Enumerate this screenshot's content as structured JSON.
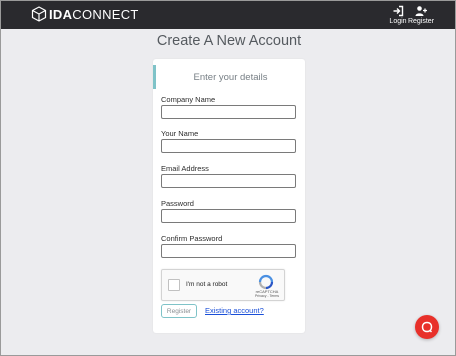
{
  "header": {
    "logo_bold": "IDA",
    "logo_light": "CONNECT",
    "nav": {
      "login_label": "Login",
      "register_label": "Register"
    }
  },
  "page": {
    "title": "Create A New Account"
  },
  "form": {
    "heading": "Enter your details",
    "fields": [
      {
        "label": "Company Name",
        "value": ""
      },
      {
        "label": "Your Name",
        "value": ""
      },
      {
        "label": "Email Address",
        "value": ""
      },
      {
        "label": "Password",
        "value": ""
      },
      {
        "label": "Confirm Password",
        "value": ""
      }
    ],
    "recaptcha": {
      "label": "I'm not a robot",
      "brand": "reCAPTCHA",
      "links": "Privacy - Terms"
    },
    "register_button": "Register",
    "existing_link": "Existing account?"
  },
  "colors": {
    "topbar": "#2a2a2e",
    "accent": "#7fc3c8",
    "link": "#1a4fd8",
    "help": "#e8302a",
    "background": "#ececef"
  },
  "icons": [
    "cube-logo-icon",
    "login-icon",
    "add-user-icon",
    "recaptcha-icon",
    "chat-help-icon"
  ]
}
